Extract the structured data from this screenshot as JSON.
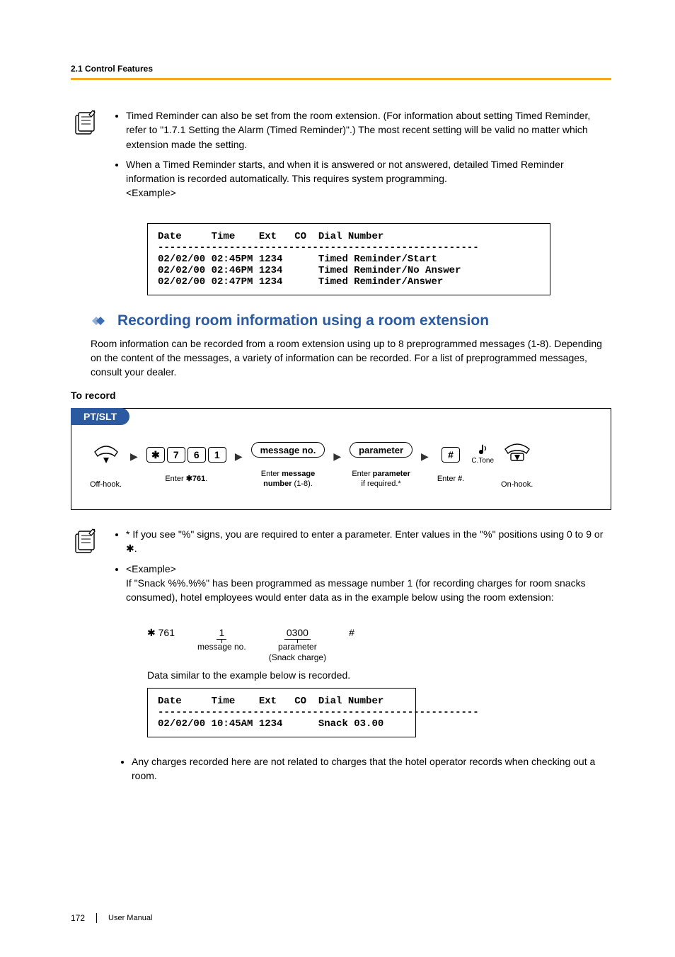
{
  "header": {
    "section_path": "2.1 Control Features"
  },
  "notes1": {
    "items": [
      "Timed Reminder can also be set from the room extension. (For information about setting Timed Reminder, refer to \"1.7.1 Setting the Alarm (Timed Reminder)\".) The most recent setting will be valid no matter which extension made the setting.",
      "When a Timed Reminder starts, and when it is answered or not answered, detailed Timed Reminder information is recorded automatically. This requires system programming.\n<Example>"
    ]
  },
  "log1": "Date     Time    Ext   CO  Dial Number\n------------------------------------------------------\n02/02/00 02:45PM 1234      Timed Reminder/Start\n02/02/00 02:46PM 1234      Timed Reminder/No Answer\n02/02/00 02:47PM 1234      Timed Reminder/Answer",
  "section": {
    "title": "Recording room information using a room extension",
    "intro": "Room information can be recorded from a room extension using up to 8 preprogrammed messages (1-8). Depending on the content of the messages, a variety of information can be recorded. For a list of preprogrammed messages, consult your dealer.",
    "subhead": "To record"
  },
  "procedure": {
    "tab": "PT/SLT",
    "keys": {
      "star": "✱",
      "k7": "7",
      "k6": "6",
      "k1": "1",
      "msg": "message no.",
      "param": "parameter",
      "hash": "#"
    },
    "ctone": "C.Tone",
    "captions": {
      "offhook": "Off-hook.",
      "enter761_pre": "Enter ",
      "enter761_code": "761",
      "entermsg_line1_pre": "Enter ",
      "entermsg_line1_bold": "message",
      "entermsg_line2_bold": "number",
      "entermsg_line2_post": " (1-8).",
      "enterparam_line1_pre": "Enter ",
      "enterparam_line1_bold": "parameter",
      "enterparam_line2": "if required.*",
      "enterhash_pre": "Enter ",
      "enterhash_bold": "#",
      "onhook": "On-hook."
    }
  },
  "notes2": {
    "item1": "* If you see \"%\" signs, you are required to enter a parameter. Enter values in the \"%\" positions using 0 to 9 or ✱.",
    "item2_lead": "<Example>",
    "item2_body": "If \"Snack %%.%%\" has been programmed as message number 1 (for recording charges for room snacks consumed), hotel employees would enter data as in the example below using the room extension:",
    "example": {
      "prefix": "✱ 761",
      "msg_val": "1",
      "msg_label": "message no.",
      "param_val": "0300",
      "param_label": "parameter",
      "param_sublabel": "(Snack charge)",
      "hash": "#"
    },
    "item2_post": "Data similar to the example below is recorded."
  },
  "log2": "Date     Time    Ext   CO  Dial Number\n------------------------------------------------------\n02/02/00 10:45AM 1234      Snack 03.00",
  "notes3": {
    "item": "Any charges recorded here are not related to charges that the hotel operator records when checking out a room."
  },
  "footer": {
    "page": "172",
    "label": "User Manual"
  }
}
